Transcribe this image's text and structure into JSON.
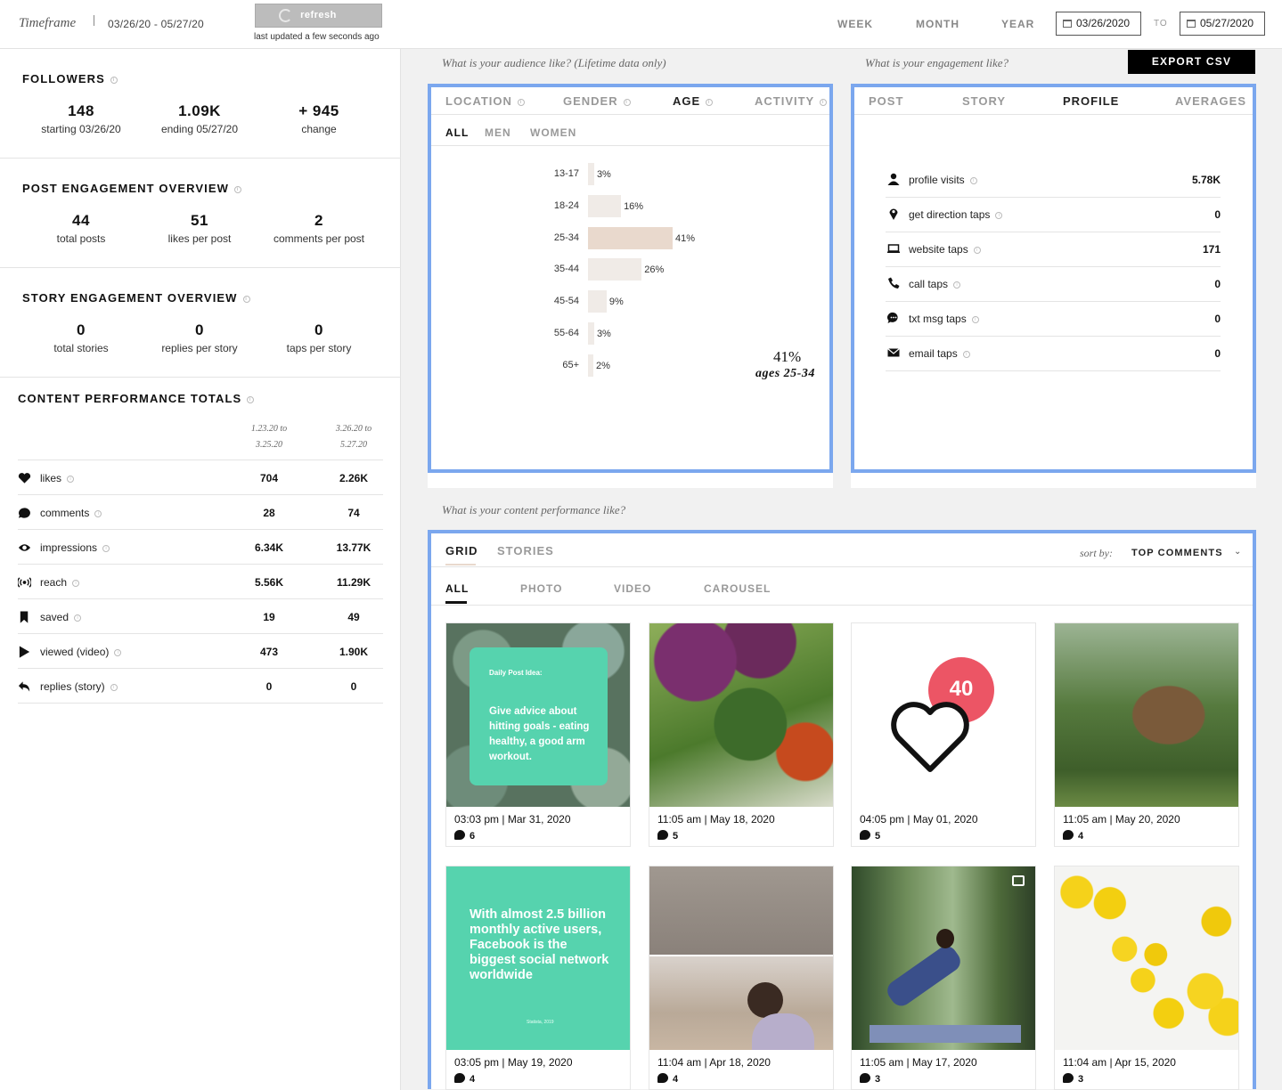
{
  "topbar": {
    "timeframe_label": "Timeframe",
    "range_text": "03/26/20 - 05/27/20",
    "refresh_label": "refresh",
    "last_updated": "last updated a few seconds ago",
    "tabs": [
      "WEEK",
      "MONTH",
      "YEAR"
    ],
    "start_date": "03/26/2020",
    "to_label": "TO",
    "end_date": "05/27/2020"
  },
  "followers": {
    "title": "FOLLOWERS",
    "stats": [
      {
        "num": "148",
        "label": "starting 03/26/20"
      },
      {
        "num": "1.09K",
        "label": "ending 05/27/20"
      },
      {
        "num": "+ 945",
        "label": "change"
      }
    ]
  },
  "post_engagement": {
    "title": "POST ENGAGEMENT OVERVIEW",
    "stats": [
      {
        "num": "44",
        "label": "total posts"
      },
      {
        "num": "51",
        "label": "likes per post"
      },
      {
        "num": "2",
        "label": "comments per post"
      }
    ]
  },
  "story_engagement": {
    "title": "STORY ENGAGEMENT OVERVIEW",
    "stats": [
      {
        "num": "0",
        "label": "total stories"
      },
      {
        "num": "0",
        "label": "replies per story"
      },
      {
        "num": "0",
        "label": "taps per story"
      }
    ]
  },
  "content_totals": {
    "title": "CONTENT PERFORMANCE TOTALS",
    "col1": [
      "1.23.20 to",
      "3.25.20"
    ],
    "col2": [
      "3.26.20 to",
      "5.27.20"
    ],
    "rows": [
      {
        "icon": "heart-icon",
        "name": "likes",
        "v1": "704",
        "v2": "2.26K"
      },
      {
        "icon": "comment-icon",
        "name": "comments",
        "v1": "28",
        "v2": "74"
      },
      {
        "icon": "eye-icon",
        "name": "impressions",
        "v1": "6.34K",
        "v2": "13.77K"
      },
      {
        "icon": "broadcast-icon",
        "name": "reach",
        "v1": "5.56K",
        "v2": "11.29K"
      },
      {
        "icon": "bookmark-icon",
        "name": "saved",
        "v1": "19",
        "v2": "49"
      },
      {
        "icon": "play-icon",
        "name": "viewed (video)",
        "v1": "473",
        "v2": "1.90K"
      },
      {
        "icon": "reply-icon",
        "name": "replies (story)",
        "v1": "0",
        "v2": "0"
      }
    ]
  },
  "audience": {
    "question": "What is your audience like? (Lifetime data only)",
    "tabs": [
      "LOCATION",
      "GENDER",
      "AGE",
      "ACTIVITY"
    ],
    "active_tab": "AGE",
    "subtabs": [
      "ALL",
      "MEN",
      "WOMEN"
    ],
    "highlight_pct": "41%",
    "highlight_label": "ages 25-34",
    "chart_data": {
      "type": "bar",
      "orientation": "horizontal",
      "categories": [
        "13-17",
        "18-24",
        "25-34",
        "35-44",
        "45-54",
        "55-64",
        "65+"
      ],
      "values": [
        3,
        16,
        41,
        26,
        9,
        3,
        2
      ],
      "value_labels": [
        "3%",
        "16%",
        "41%",
        "26%",
        "9%",
        "3%",
        "2%"
      ],
      "color": "#f0ebe7",
      "highlight_color": "#e9d9cd"
    }
  },
  "engagement": {
    "question": "What is your engagement like?",
    "export_label": "EXPORT CSV",
    "tabs": [
      "POST",
      "STORY",
      "PROFILE",
      "AVERAGES"
    ],
    "active_tab": "PROFILE",
    "rows": [
      {
        "icon": "user-icon",
        "name": "profile visits",
        "value": "5.78K"
      },
      {
        "icon": "location-pin-icon",
        "name": "get direction taps",
        "value": "0"
      },
      {
        "icon": "laptop-icon",
        "name": "website taps",
        "value": "171"
      },
      {
        "icon": "phone-icon",
        "name": "call taps",
        "value": "0"
      },
      {
        "icon": "message-icon",
        "name": "txt msg taps",
        "value": "0"
      },
      {
        "icon": "envelope-icon",
        "name": "email taps",
        "value": "0"
      }
    ]
  },
  "content": {
    "question": "What is your content performance like?",
    "tabs": [
      "GRID",
      "STORIES"
    ],
    "sort_label": "sort by:",
    "sort_value": "TOP COMMENTS",
    "subtabs": [
      "ALL",
      "PHOTO",
      "VIDEO",
      "CAROUSEL"
    ],
    "posts": [
      {
        "time": "03:03 pm  |  Mar 31, 2020",
        "comments": "6",
        "img_title": "Daily Post Idea:",
        "img_text": "Give advice about hitting goals - eating healthy, a good arm workout."
      },
      {
        "time": "11:05 am  |  May 18, 2020",
        "comments": "5"
      },
      {
        "time": "04:05 pm  |  May 01, 2020",
        "comments": "5",
        "img_badge": "40"
      },
      {
        "time": "11:05 am  |  May 20, 2020",
        "comments": "4"
      },
      {
        "time": "03:05 pm  |  May 19, 2020",
        "comments": "4",
        "img_text": "With almost 2.5 billion monthly active users, Facebook is the biggest social network worldwide",
        "img_source": "Statista, 2019"
      },
      {
        "time": "11:04 am  |  Apr 18, 2020",
        "comments": "4"
      },
      {
        "time": "11:05 am  |  May 17, 2020",
        "comments": "3"
      },
      {
        "time": "11:04 am  |  Apr 15, 2020",
        "comments": "3"
      }
    ]
  }
}
